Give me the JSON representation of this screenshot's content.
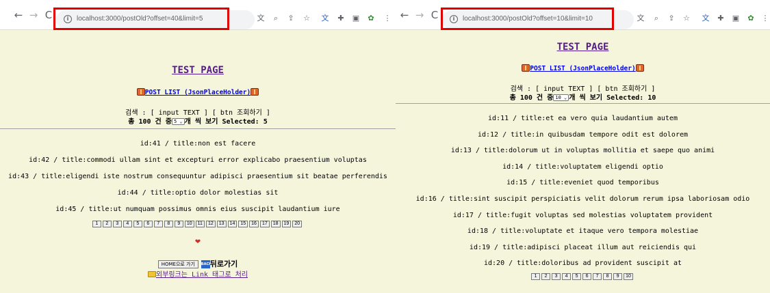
{
  "left": {
    "url": "localhost:3000/postOld?offset=40&limit=5",
    "title": "TEST PAGE",
    "subtitle": "POST LIST (JsonPlaceHolder)",
    "search_line": "검색 : [ input TEXT ] [ btn 조회하기 ]",
    "count_prefix": "총 100 건 중",
    "select_value": "5",
    "count_suffix": "개 씩 보기 Selected: ",
    "selected": "5",
    "posts": [
      "id:41 / title:non est facere",
      "id:42 / title:commodi ullam sint et excepturi error explicabo praesentium voluptas",
      "id:43 / title:eligendi iste nostrum consequuntur adipisci praesentium sit beatae perferendis",
      "id:44 / title:optio dolor molestias sit",
      "id:45 / title:ut numquam possimus omnis eius suscipit laudantium iure"
    ],
    "pages": [
      "1",
      "2",
      "3",
      "4",
      "5",
      "6",
      "7",
      "8",
      "9",
      "10",
      "11",
      "12",
      "13",
      "14",
      "15",
      "16",
      "17",
      "18",
      "19",
      "20"
    ],
    "heart": "❤",
    "home_button": "HOME으로 가기",
    "back_icon_text": "BACK",
    "back_label": "뒤로가기",
    "external_link": "외부링크는 Link 태그로 처리"
  },
  "right": {
    "url": "localhost:3000/postOld?offset=10&limit=10",
    "title": "TEST PAGE",
    "subtitle": "POST LIST (JsonPlaceHolder)",
    "search_line": "검색 : [ input TEXT ] [ btn 조회하기 ]",
    "count_prefix": "총 100 건 중",
    "select_value": "10",
    "count_suffix": "개 씩 보기 Selected: ",
    "selected": "10",
    "posts": [
      "id:11 / title:et ea vero quia laudantium autem",
      "id:12 / title:in quibusdam tempore odit est dolorem",
      "id:13 / title:dolorum ut in voluptas mollitia et saepe quo animi",
      "id:14 / title:voluptatem eligendi optio",
      "id:15 / title:eveniet quod temporibus",
      "id:16 / title:sint suscipit perspiciatis velit dolorum rerum ipsa laboriosam odio",
      "id:17 / title:fugit voluptas sed molestias voluptatem provident",
      "id:18 / title:voluptate et itaque vero tempora molestiae",
      "id:19 / title:adipisci placeat illum aut reiciendis qui",
      "id:20 / title:doloribus ad provident suscipit at"
    ],
    "pages": [
      "1",
      "2",
      "3",
      "4",
      "5",
      "6",
      "7",
      "8",
      "9",
      "10"
    ]
  },
  "icons": {
    "back": "←",
    "forward": "→",
    "reload": "C",
    "info": "i",
    "translate": "translate-icon",
    "zoom": "zoom-icon",
    "share": "share-icon",
    "star": "☆",
    "extension": "extension-icon",
    "puzzle": "puzzle-icon",
    "sidebar": "sidebar-icon",
    "profile": "profile-icon",
    "menu": "⋮"
  },
  "colors": {
    "page_bg": "#f5f5dc",
    "highlight": "#e00000",
    "link": "#0000ee",
    "visited": "#551a8b"
  }
}
